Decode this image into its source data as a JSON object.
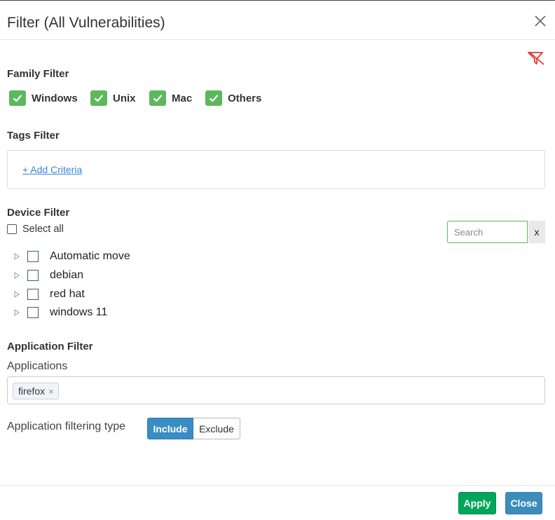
{
  "modal": {
    "title": "Filter (All Vulnerabilities)"
  },
  "family_filter": {
    "label": "Family Filter",
    "items": [
      {
        "label": "Windows",
        "checked": true
      },
      {
        "label": "Unix",
        "checked": true
      },
      {
        "label": "Mac",
        "checked": true
      },
      {
        "label": "Others",
        "checked": true
      }
    ],
    "check_color": "#5cb85c"
  },
  "tags_filter": {
    "label": "Tags Filter",
    "add_criteria": "+ Add Criteria"
  },
  "device_filter": {
    "label": "Device Filter",
    "select_all": "Select all",
    "search_placeholder": "Search",
    "search_value": "",
    "search_clear": "x",
    "tree": [
      {
        "label": "Automatic move",
        "checked": false
      },
      {
        "label": "debian",
        "checked": false
      },
      {
        "label": "red hat",
        "checked": false
      },
      {
        "label": "windows 11",
        "checked": false
      }
    ]
  },
  "application_filter": {
    "label": "Application Filter",
    "applications_label": "Applications",
    "selected": [
      {
        "label": "firefox",
        "remove": "×"
      }
    ],
    "filtering_type_label": "Application filtering type",
    "options": [
      "Include",
      "Exclude"
    ],
    "selected_option": "Include"
  },
  "footer": {
    "apply": "Apply",
    "close": "Close"
  },
  "colors": {
    "accent_blue": "#3c8dbc",
    "apply_green": "#00a65a",
    "clear_filter_red": "#e53935"
  }
}
